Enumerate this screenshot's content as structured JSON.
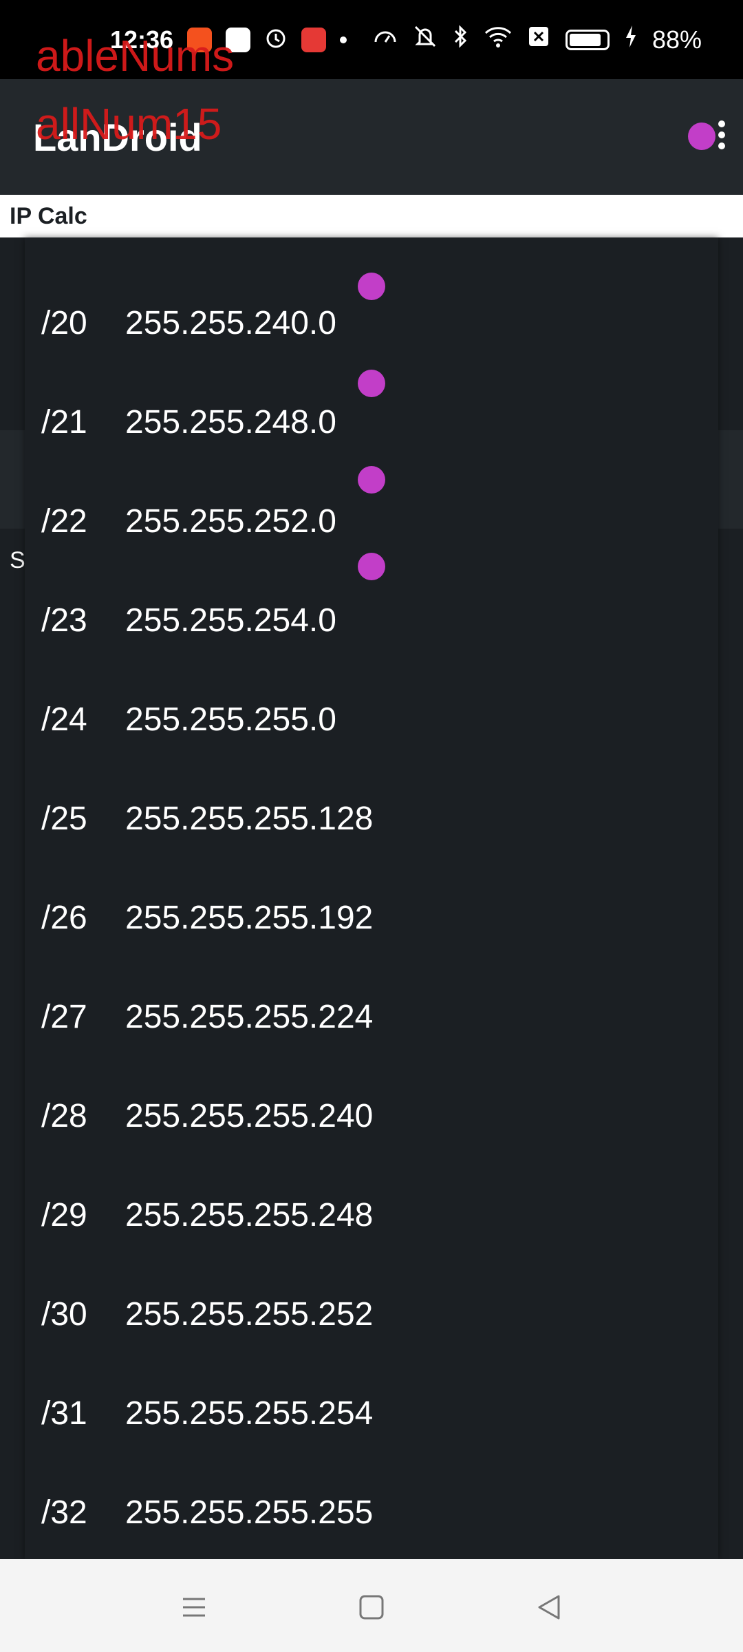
{
  "status": {
    "time": "12:36",
    "battery": "88%",
    "battery_level": 0.88
  },
  "overlay": {
    "line1": "ableNums",
    "line2": "allNum15"
  },
  "app": {
    "title": "LanDroid"
  },
  "tab": {
    "label": "IP Calc"
  },
  "background": {
    "letter": "S"
  },
  "netmasks": [
    {
      "prefix": "/20",
      "mask": "255.255.240.0"
    },
    {
      "prefix": "/21",
      "mask": "255.255.248.0"
    },
    {
      "prefix": "/22",
      "mask": "255.255.252.0"
    },
    {
      "prefix": "/23",
      "mask": "255.255.254.0"
    },
    {
      "prefix": "/24",
      "mask": "255.255.255.0"
    },
    {
      "prefix": "/25",
      "mask": "255.255.255.128"
    },
    {
      "prefix": "/26",
      "mask": "255.255.255.192"
    },
    {
      "prefix": "/27",
      "mask": "255.255.255.224"
    },
    {
      "prefix": "/28",
      "mask": "255.255.255.240"
    },
    {
      "prefix": "/29",
      "mask": "255.255.255.248"
    },
    {
      "prefix": "/30",
      "mask": "255.255.255.252"
    },
    {
      "prefix": "/31",
      "mask": "255.255.255.254"
    },
    {
      "prefix": "/32",
      "mask": "255.255.255.255"
    }
  ],
  "colors": {
    "marker": "#c23ec8",
    "overlay_text": "#d81b1b"
  }
}
